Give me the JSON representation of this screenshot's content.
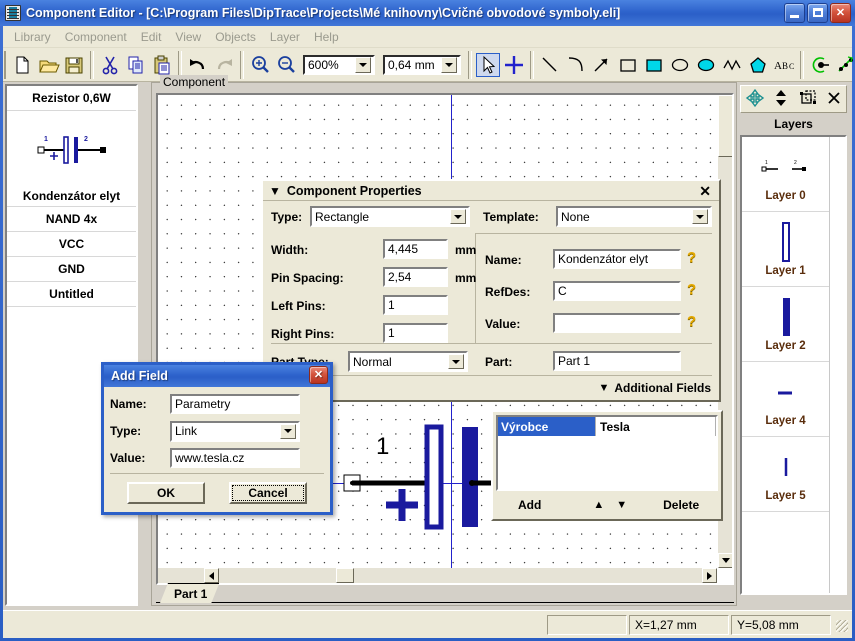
{
  "window": {
    "title": "Component Editor - [C:\\Program Files\\DipTrace\\Projects\\Mé knihovny\\Cvičné obvodové symboly.eli]",
    "minimize_label": "_",
    "maximize_label": "□",
    "close_label": "✕"
  },
  "menubar": {
    "items": [
      {
        "label": "Library"
      },
      {
        "label": "Component"
      },
      {
        "label": "Edit"
      },
      {
        "label": "View"
      },
      {
        "label": "Objects"
      },
      {
        "label": "Layer"
      },
      {
        "label": "Help"
      }
    ]
  },
  "toolbar": {
    "icons": [
      {
        "name": "new-icon",
        "title": "New"
      },
      {
        "name": "open-icon",
        "title": "Open"
      },
      {
        "name": "save-icon",
        "title": "Save"
      },
      {
        "name": "cut-icon",
        "title": "Cut"
      },
      {
        "name": "copy-icon",
        "title": "Copy"
      },
      {
        "name": "paste-icon",
        "title": "Paste"
      },
      {
        "name": "undo-icon",
        "title": "Undo"
      },
      {
        "name": "redo-icon",
        "title": "Redo"
      },
      {
        "name": "zoom-in-icon",
        "title": "Zoom In"
      },
      {
        "name": "zoom-out-icon",
        "title": "Zoom Out"
      }
    ],
    "zoom_value": "600%",
    "grid_value": "0,64 mm",
    "draw_icons": [
      {
        "name": "select-arrow-icon"
      },
      {
        "name": "crosshair-icon"
      },
      {
        "name": "line-icon"
      },
      {
        "name": "arc-icon"
      },
      {
        "name": "arrow-icon"
      },
      {
        "name": "rectangle-icon"
      },
      {
        "name": "filled-rectangle-icon"
      },
      {
        "name": "ellipse-icon"
      },
      {
        "name": "filled-ellipse-icon"
      },
      {
        "name": "polyline-icon"
      },
      {
        "name": "polygon-icon"
      },
      {
        "name": "text-icon"
      }
    ],
    "pin_icons": [
      {
        "name": "add-pin-icon"
      },
      {
        "name": "pin-array-icon"
      },
      {
        "name": "pin-matrix-icon"
      },
      {
        "name": "pin-spread-icon"
      }
    ]
  },
  "component_list": {
    "items": [
      {
        "label": "Rezistor 0,6W",
        "selected": false,
        "has_preview": false
      },
      {
        "label": "Kondenzátor elyt",
        "selected": true,
        "has_preview": true
      },
      {
        "label": "NAND 4x",
        "selected": false,
        "has_preview": false
      },
      {
        "label": "VCC",
        "selected": false,
        "has_preview": false
      },
      {
        "label": "GND",
        "selected": false,
        "has_preview": false
      },
      {
        "label": "Untitled",
        "selected": false,
        "has_preview": false
      }
    ]
  },
  "component_group": {
    "title": "Component",
    "part_tab": "Part 1",
    "pin_labels": [
      "1",
      "2"
    ],
    "plus_marker": "+"
  },
  "properties": {
    "header": "Component Properties",
    "collapse_icon": "▼",
    "close_icon": "✕",
    "type_label": "Type:",
    "type_value": "Rectangle",
    "template_label": "Template:",
    "template_value": "None",
    "width_label": "Width:",
    "width_value": "4,445",
    "width_unit": "mm",
    "pin_spacing_label": "Pin Spacing:",
    "pin_spacing_value": "2,54",
    "pin_spacing_unit": "mm",
    "left_pins_label": "Left Pins:",
    "left_pins_value": "1",
    "right_pins_label": "Right Pins:",
    "right_pins_value": "1",
    "name_label": "Name:",
    "name_value": "Kondenzátor elyt",
    "refdes_label": "RefDes:",
    "refdes_value": "C",
    "value_label": "Value:",
    "value_value": "",
    "part_type_label": "Part Type:",
    "part_type_value": "Normal",
    "part_label": "Part:",
    "part_value": "Part 1",
    "additional_fields_label": "Additional Fields",
    "additional_fields_icon": "▼",
    "help_icon": "?"
  },
  "additional_fields": {
    "rows": [
      {
        "name": "Výrobce",
        "value": "Tesla",
        "selected": true
      }
    ],
    "add_label": "Add",
    "delete_label": "Delete",
    "up_icon": "▲",
    "down_icon": "▼"
  },
  "layers": {
    "title": "Layers",
    "toolbar_icons": [
      {
        "name": "move-layer-icon"
      },
      {
        "name": "reorder-layer-icon"
      },
      {
        "name": "layer-properties-icon"
      },
      {
        "name": "delete-layer-icon"
      }
    ],
    "items": [
      {
        "label": "Layer 0",
        "symbol": "pins"
      },
      {
        "label": "Layer 1",
        "symbol": "hollow-bar"
      },
      {
        "label": "Layer 2",
        "symbol": "solid-bar"
      },
      {
        "label": "Layer 4",
        "symbol": "short-dash"
      },
      {
        "label": "Layer 5",
        "symbol": "short-tick"
      }
    ]
  },
  "add_field_dialog": {
    "title": "Add Field",
    "close_icon": "✕",
    "name_label": "Name:",
    "name_value": "Parametry",
    "type_label": "Type:",
    "type_value": "Link",
    "value_label": "Value:",
    "value_value": "www.tesla.cz",
    "ok_label": "OK",
    "cancel_label": "Cancel"
  },
  "statusbar": {
    "x_coord": "X=1,27 mm",
    "y_coord": "Y=5,08 mm"
  },
  "colors": {
    "title_blue": "#2b5fc8",
    "face": "#ece9d8",
    "accent_draw": "#1a1a9e",
    "selection_blue": "#2b5fc8",
    "layer_label": "#5a2d0c"
  }
}
